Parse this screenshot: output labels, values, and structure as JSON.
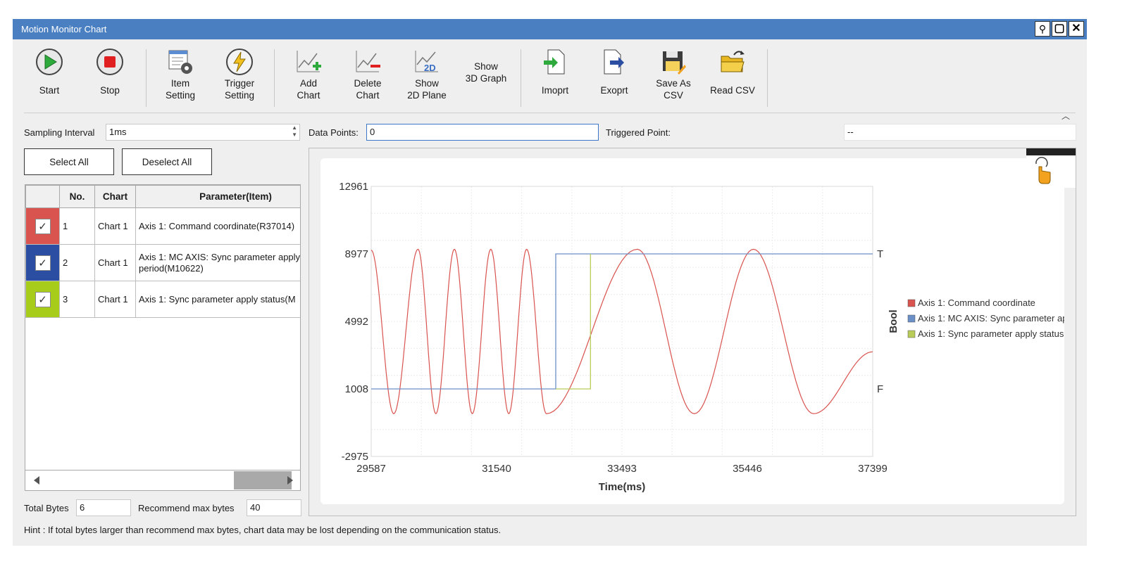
{
  "window": {
    "title": "Motion Monitor Chart",
    "pin_glyph": "⚲",
    "max_glyph": "▢",
    "close_glyph": "✕"
  },
  "toolbar": {
    "start": "Start",
    "stop": "Stop",
    "item_setting": "Item\nSetting",
    "trigger_setting": "Trigger\nSetting",
    "add_chart": "Add\nChart",
    "delete_chart": "Delete\nChart",
    "show_2d": "Show\n2D Plane",
    "show_3d": "Show\n3D Graph",
    "import": "Imoprt",
    "export": "Exoprt",
    "save_csv": "Save As\nCSV",
    "read_csv": "Read CSV",
    "icon_2d_text": "2D",
    "collapse_glyph": "︿"
  },
  "controls": {
    "sampling_label": "Sampling Interval",
    "sampling_value": "1ms",
    "data_points_label": "Data Points:",
    "data_points_value": "0",
    "triggered_label": "Triggered Point:",
    "triggered_value": "--",
    "select_all": "Select All",
    "deselect_all": "Deselect All",
    "total_bytes_label": "Total Bytes",
    "total_bytes_value": "6",
    "recommend_label": "Recommend max bytes",
    "recommend_value": "40",
    "hint": "Hint : If total bytes larger than recommend max bytes, chart data may be lost depending on the communication status."
  },
  "table": {
    "headers": [
      "",
      "No.",
      "Chart",
      "Parameter(Item)"
    ],
    "rows": [
      {
        "color": "#d9534f",
        "check": "✓",
        "no": "1",
        "chart": "Chart 1",
        "param": "Axis 1: Command coordinate(R37014)"
      },
      {
        "color": "#2b4ea2",
        "check": "✓",
        "no": "2",
        "chart": "Chart 1",
        "param": "Axis 1: MC AXIS: Sync parameter apply",
        "param2": "period(M10622)"
      },
      {
        "color": "#a8cc1a",
        "check": "✓",
        "no": "3",
        "chart": "Chart 1",
        "param": "Axis 1: Sync parameter apply status(M"
      }
    ]
  },
  "chart_data": {
    "type": "line",
    "xlabel": "Time(ms)",
    "ylabel_right": "Bool",
    "xlim": [
      29587,
      37399
    ],
    "ylim": [
      -2975,
      12961
    ],
    "x_ticks": [
      "29587",
      "31540",
      "33493",
      "35446",
      "37399"
    ],
    "y_ticks": [
      "12961",
      "8977",
      "4992",
      "1008",
      "-2975"
    ],
    "right_ticks": [
      "T",
      "F"
    ],
    "legend_position": "right",
    "series": [
      {
        "name": "Axis 1: Command coordinate",
        "color": "#d9534f",
        "kind": "sine",
        "peaks": [
          30316,
          30883,
          31450,
          32008,
          33733,
          35542
        ],
        "troughs": [
          29938,
          30594,
          31162,
          31730,
          32316,
          34620,
          36477
        ],
        "max": 9250,
        "min": -450,
        "start_value": 9200,
        "end_value": 3200
      },
      {
        "name": "Axis 1: MC AXIS: Sync parameter ap...",
        "color": "#6b8fc7",
        "kind": "step",
        "points": [
          [
            29587,
            0
          ],
          [
            32462,
            0
          ],
          [
            32462,
            1
          ],
          [
            37399,
            1
          ]
        ]
      },
      {
        "name": "Axis 1: Sync parameter apply status",
        "color": "#b9cc5a",
        "kind": "step",
        "points": [
          [
            32462,
            0
          ],
          [
            33003,
            0
          ],
          [
            33003,
            1
          ],
          [
            33003,
            1
          ]
        ]
      }
    ]
  }
}
